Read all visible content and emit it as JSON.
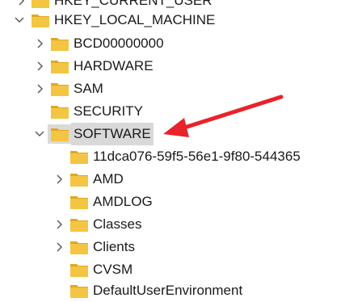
{
  "tree": {
    "nodes": [
      {
        "label": "HKEY_CURRENT_USER",
        "expander": "collapsed"
      },
      {
        "label": "HKEY_LOCAL_MACHINE",
        "expander": "expanded"
      },
      {
        "label": "BCD00000000",
        "expander": "collapsed"
      },
      {
        "label": "HARDWARE",
        "expander": "collapsed"
      },
      {
        "label": "SAM",
        "expander": "collapsed"
      },
      {
        "label": "SECURITY",
        "expander": "none"
      },
      {
        "label": "SOFTWARE",
        "expander": "expanded",
        "selected": true
      },
      {
        "label": "11dca076-59f5-56e1-9f80-544365",
        "expander": "none"
      },
      {
        "label": "AMD",
        "expander": "collapsed"
      },
      {
        "label": "AMDLOG",
        "expander": "none"
      },
      {
        "label": "Classes",
        "expander": "collapsed"
      },
      {
        "label": "Clients",
        "expander": "collapsed"
      },
      {
        "label": "CVSM",
        "expander": "none"
      },
      {
        "label": "DefaultUserEnvironment",
        "expander": "none"
      }
    ]
  },
  "colors": {
    "folder": "#f4c542",
    "folder_dark": "#e0a81e",
    "selection": "#d9d9d9",
    "arrow": "#e8232a"
  },
  "icons": {
    "expanded": "chevron-down-icon",
    "collapsed": "chevron-right-icon",
    "folder": "folder-icon"
  }
}
